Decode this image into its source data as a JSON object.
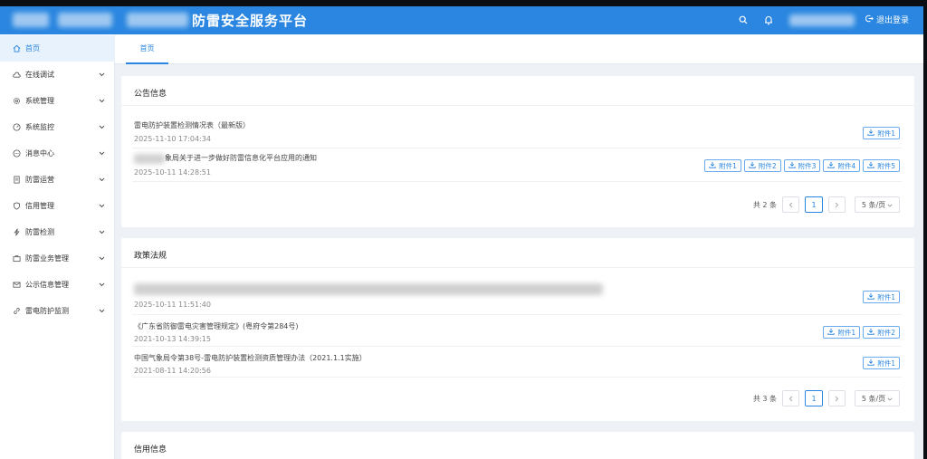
{
  "header": {
    "app_title": "防雷安全服务平台",
    "logout_label": "退出登录",
    "icons": [
      "search-icon",
      "bell-icon",
      "logout-icon"
    ],
    "colors": {
      "primary": "#2a86e0",
      "sidebar_active_bg": "#e8f2fd"
    }
  },
  "sidebar": {
    "items": [
      {
        "label": "首页",
        "icon": "home-icon",
        "active": true
      },
      {
        "label": "在线调试",
        "icon": "cloud-icon"
      },
      {
        "label": "系统管理",
        "icon": "gear-icon"
      },
      {
        "label": "系统监控",
        "icon": "gauge-icon"
      },
      {
        "label": "消息中心",
        "icon": "chat-icon"
      },
      {
        "label": "防雷运营",
        "icon": "document-icon"
      },
      {
        "label": "信用管理",
        "icon": "shield-icon"
      },
      {
        "label": "防雷检测",
        "icon": "lightning-icon"
      },
      {
        "label": "防雷业务管理",
        "icon": "briefcase-icon"
      },
      {
        "label": "公示信息管理",
        "icon": "mail-icon"
      },
      {
        "label": "雷电防护监测",
        "icon": "link-icon"
      }
    ]
  },
  "tabs": [
    {
      "label": "首页"
    }
  ],
  "announcements": {
    "title": "公告信息",
    "rows": [
      {
        "title": "雷电防护装置检测情况表（最新版）",
        "date": "2025-11-10 17:04:34",
        "attachments": [
          "附件1"
        ]
      },
      {
        "title": "象局关于进一步做好防雷信息化平台应用的通知",
        "date": "2025-10-11 14:28:51",
        "attachments": [
          "附件1",
          "附件2",
          "附件3",
          "附件4",
          "附件5"
        ]
      }
    ],
    "total": "共 2 条",
    "page": "1",
    "page_size": "5 条/页"
  },
  "policies": {
    "title": "政策法规",
    "rows": [
      {
        "title": "",
        "date": "2025-10-11 11:51:40",
        "attachments": [
          "附件1"
        ]
      },
      {
        "title": "《广东省防御雷电灾害管理规定》(粤府令第284号)",
        "date": "2021-10-13 14:39:15",
        "attachments": [
          "附件1",
          "附件2"
        ]
      },
      {
        "title": "中国气象局令第38号-雷电防护装置检测资质管理办法（2021.1.1实施）",
        "date": "2021-08-11 14:20:56",
        "attachments": [
          "附件1"
        ]
      }
    ],
    "total": "共 3 条",
    "page": "1",
    "page_size": "5 条/页"
  },
  "credit": {
    "title": "信用信息"
  }
}
